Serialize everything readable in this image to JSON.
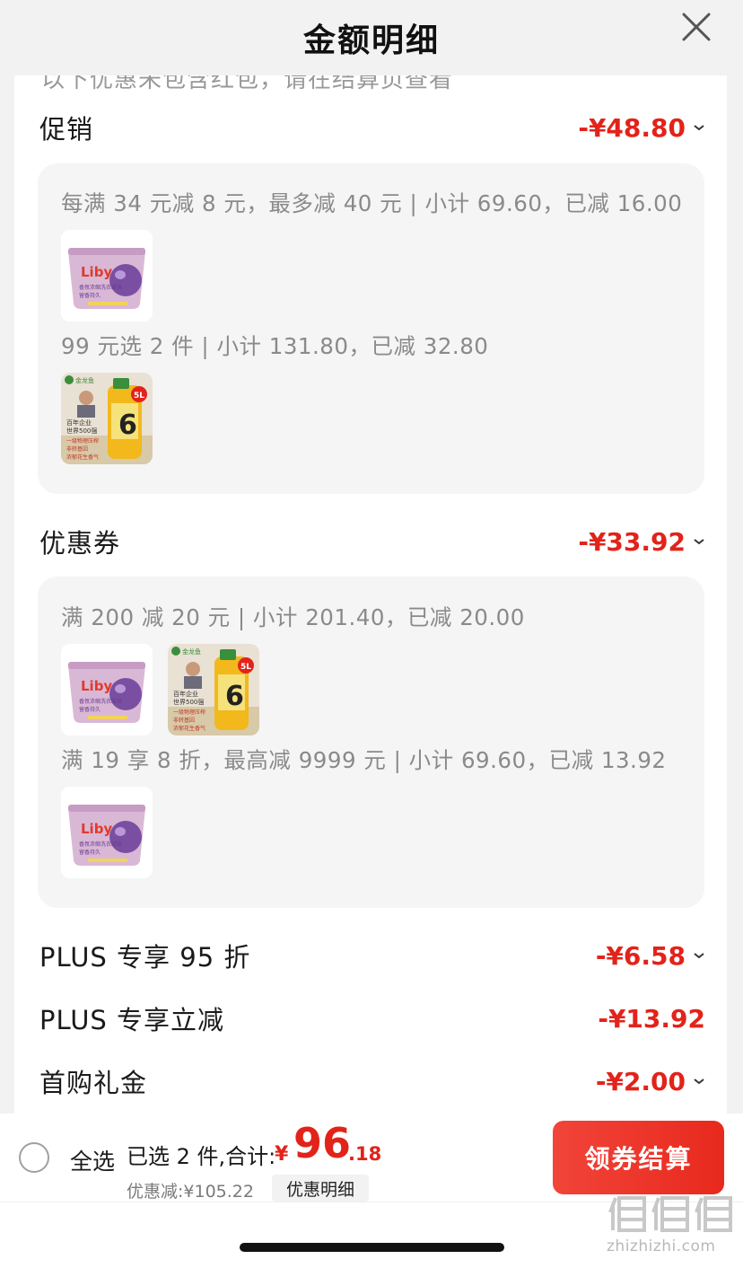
{
  "header": {
    "title": "金额明细"
  },
  "partial_text": "以下优惠未包含红包，请在结算页查看",
  "promotion": {
    "label": "促销",
    "amount": "-¥48.80",
    "groups": [
      {
        "text": "每满 34 元减 8 元，最多减 40 元 | 小计 69.60，已减 16.00",
        "items": [
          "detergent-pods"
        ]
      },
      {
        "text": "99 元选 2 件 | 小计 131.80，已减 32.80",
        "items": [
          "cooking-oil"
        ]
      }
    ]
  },
  "coupon": {
    "label": "优惠券",
    "amount": "-¥33.92",
    "groups": [
      {
        "text": "满 200 减 20 元 | 小计 201.40，已减 20.00",
        "items": [
          "detergent-pods",
          "cooking-oil"
        ]
      },
      {
        "text": "满 19 享 8 折，最高减 9999 元 | 小计 69.60，已减 13.92",
        "items": [
          "detergent-pods"
        ]
      }
    ]
  },
  "plus_discount": {
    "label": "PLUS 专享 95 折",
    "amount": "-¥6.58"
  },
  "plus_instant": {
    "label": "PLUS 专享立减",
    "amount": "-¥13.92"
  },
  "first_gift": {
    "label": "首购礼金",
    "amount": "-¥2.00"
  },
  "products": {
    "pods": {
      "brand": "Liby",
      "line1": "香氛浓缩洗衣凝珠",
      "line2": "留香持久"
    },
    "oil": {
      "brand": "金龙鱼",
      "badge": "5L",
      "line1": "百年企业",
      "line2": "世界500强",
      "line3": "一级物理压榨",
      "line4": "非转基因",
      "line5": "浓郁花生香气",
      "big": "6"
    }
  },
  "footer": {
    "select_all": "全选",
    "selected": "已选 2 件,合计:",
    "yen": "¥",
    "total_int": "96",
    "total_dec": ".18",
    "discount_label": "优惠减:¥105.22",
    "discount_button": "优惠明细",
    "checkout": "领券结算"
  },
  "watermark": "zhizhizhi.com",
  "colors": {
    "accent": "#e2231a",
    "checkout": "#ef3b31",
    "panel": "#f5f5f5"
  }
}
